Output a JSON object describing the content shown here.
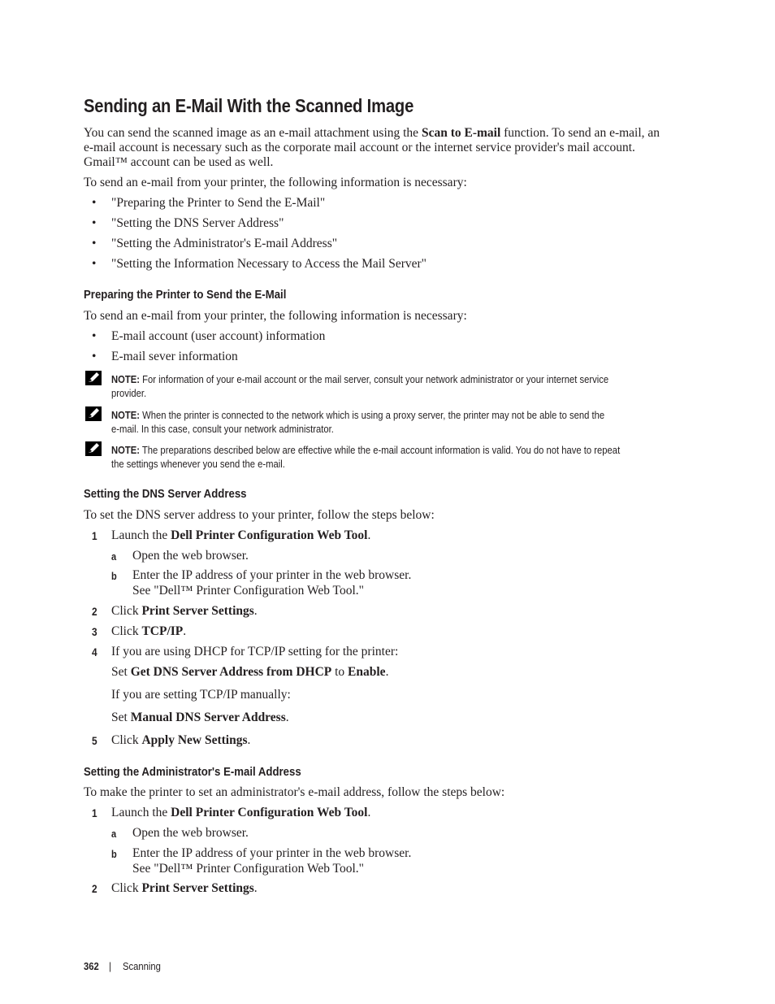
{
  "title": "Sending an E-Mail With the Scanned Image",
  "intro": {
    "line1_a": "You can send the scanned image as an e-mail attachment using the ",
    "line1_b": "Scan to E-mail",
    "line1_c": " function. To send an e-mail, an",
    "line2": "e-mail account is necessary such as the corporate mail account or the internet service provider's mail account.",
    "line3": "Gmail™ account can be used as well."
  },
  "info_needed": "To send an e-mail from your printer, the following information is necessary:",
  "links": [
    "\"Preparing the Printer to Send the E-Mail\"",
    "\"Setting the DNS Server Address\"",
    "\"Setting the Administrator's E-mail Address\"",
    "\"Setting the Information Necessary to Access the Mail Server\""
  ],
  "section1": {
    "heading": "Preparing the Printer to Send the E-Mail",
    "intro": "To send an e-mail from your printer, the following information is necessary:",
    "bullets": [
      "E-mail account (user account) information",
      "E-mail sever information"
    ],
    "notes": [
      {
        "label": "NOTE:",
        "line1": " For information of your e-mail account or the mail server, consult your network administrator or your internet service",
        "line2": "provider."
      },
      {
        "label": "NOTE:",
        "line1": " When the printer is connected to the network which is using a proxy server, the printer may not be able to send the",
        "line2": "e-mail. In this case, consult your network administrator."
      },
      {
        "label": "NOTE:",
        "line1": " The preparations described below are effective while the e-mail account information is valid. You do not have to repeat",
        "line2": "the settings whenever you send the e-mail."
      }
    ]
  },
  "section2": {
    "heading": "Setting the DNS Server Address",
    "intro": "To set the DNS server address to your printer, follow the steps below:",
    "s1_num": "1",
    "s1_a": "Launch the ",
    "s1_b": "Dell Printer Configuration Web Tool",
    "s1_c": ".",
    "sa_let": "a",
    "sa": "Open the web browser.",
    "sb_let": "b",
    "sb1": "Enter the IP address of your printer in the web browser.",
    "sb2": "See \"Dell™ Printer Configuration Web Tool.\"",
    "s2_num": "2",
    "s2_a": "Click ",
    "s2_b": "Print Server Settings",
    "s2_c": ".",
    "s3_num": "3",
    "s3_a": "Click ",
    "s3_b": "TCP/IP",
    "s3_c": ".",
    "s4_num": "4",
    "s4": "If you are using DHCP for TCP/IP setting for the printer:",
    "s4_set_a": "Set ",
    "s4_set_b": "Get DNS Server Address from DHCP",
    "s4_set_c": " to ",
    "s4_set_d": "Enable",
    "s4_set_e": ".",
    "s4_manual": "If you are setting TCP/IP manually:",
    "s4_man_a": "Set ",
    "s4_man_b": "Manual DNS Server Address",
    "s4_man_c": ".",
    "s5_num": "5",
    "s5_a": "Click ",
    "s5_b": "Apply New Settings",
    "s5_c": "."
  },
  "section3": {
    "heading": "Setting the Administrator's E-mail Address",
    "intro": "To make the printer to set an administrator's e-mail address, follow the steps below:",
    "s1_num": "1",
    "s1_a": "Launch the ",
    "s1_b": "Dell Printer Configuration Web Tool",
    "s1_c": ".",
    "sa_let": "a",
    "sa": "Open the web browser.",
    "sb_let": "b",
    "sb1": "Enter the IP address of your printer in the web browser.",
    "sb2": "See \"Dell™ Printer Configuration Web Tool.\"",
    "s2_num": "2",
    "s2_a": "Click ",
    "s2_b": "Print Server Settings",
    "s2_c": "."
  },
  "footer": {
    "page": "362",
    "sep": "|",
    "chapter": "Scanning"
  }
}
